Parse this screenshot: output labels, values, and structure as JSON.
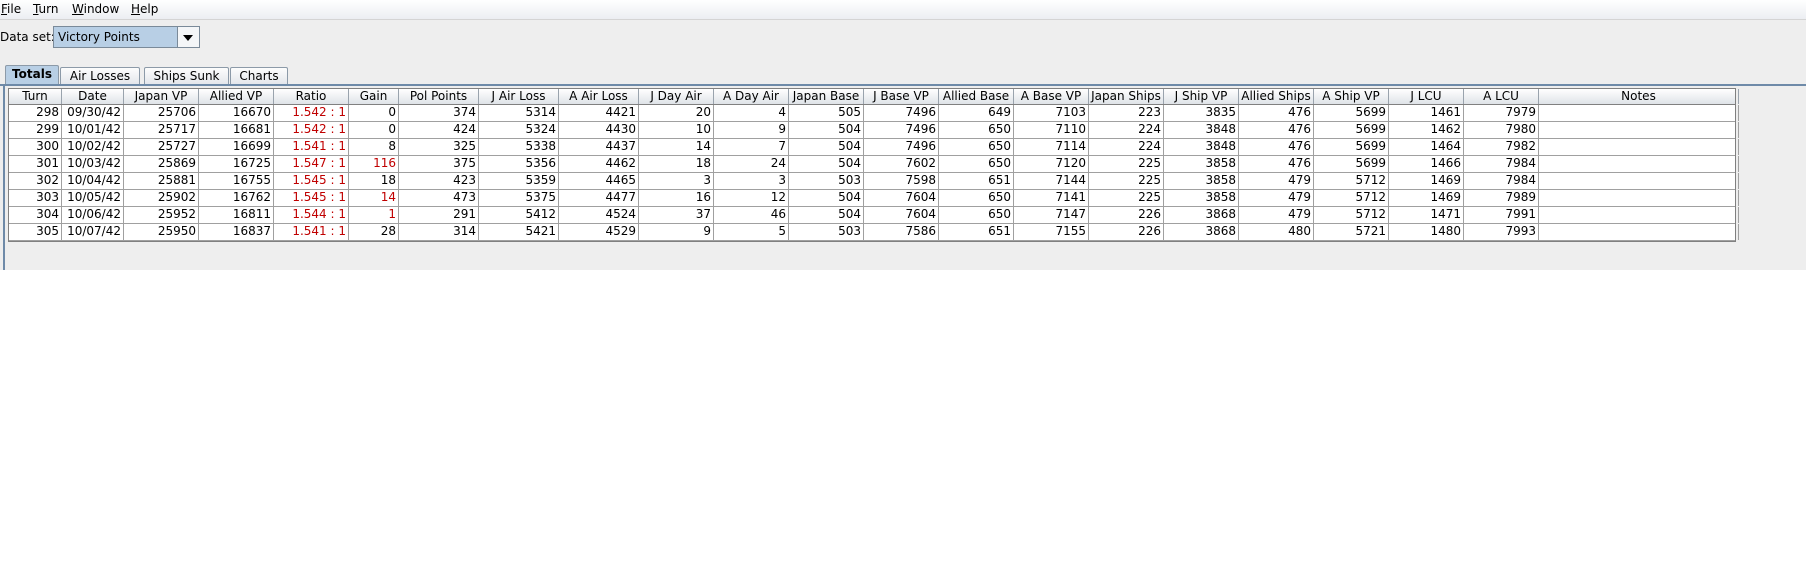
{
  "menubar": {
    "items": [
      {
        "mnemonic": "F",
        "rest": "ile"
      },
      {
        "mnemonic": "T",
        "rest": "urn"
      },
      {
        "mnemonic": "W",
        "rest": "indow"
      },
      {
        "mnemonic": "H",
        "rest": "elp"
      }
    ]
  },
  "dataset": {
    "label": "Data set:",
    "value": "Victory Points"
  },
  "tabs": [
    {
      "label": "Totals",
      "active": true
    },
    {
      "label": "Air Losses",
      "active": false
    },
    {
      "label": "Ships Sunk",
      "active": false
    },
    {
      "label": "Charts",
      "active": false
    }
  ],
  "table": {
    "columns": [
      "Turn",
      "Date",
      "Japan VP",
      "Allied VP",
      "Ratio",
      "Gain",
      "Pol Points",
      "J Air Loss",
      "A Air Loss",
      "J Day Air",
      "A Day Air",
      "Japan Base",
      "J Base VP",
      "Allied Base",
      "A Base VP",
      "Japan Ships",
      "J Ship VP",
      "Allied Ships",
      "A Ship VP",
      "J LCU",
      "A LCU",
      "Notes"
    ],
    "highlight_color": "#c00000",
    "rows": [
      {
        "cells": [
          "298",
          "09/30/42",
          "25706",
          "16670",
          "1.542 : 1",
          "0",
          "374",
          "5314",
          "4421",
          "20",
          "4",
          "505",
          "7496",
          "649",
          "7103",
          "223",
          "3835",
          "476",
          "5699",
          "1461",
          "7979",
          ""
        ],
        "red": [
          4
        ]
      },
      {
        "cells": [
          "299",
          "10/01/42",
          "25717",
          "16681",
          "1.542 : 1",
          "0",
          "424",
          "5324",
          "4430",
          "10",
          "9",
          "504",
          "7496",
          "650",
          "7110",
          "224",
          "3848",
          "476",
          "5699",
          "1462",
          "7980",
          ""
        ],
        "red": [
          4
        ]
      },
      {
        "cells": [
          "300",
          "10/02/42",
          "25727",
          "16699",
          "1.541 : 1",
          "8",
          "325",
          "5338",
          "4437",
          "14",
          "7",
          "504",
          "7496",
          "650",
          "7114",
          "224",
          "3848",
          "476",
          "5699",
          "1464",
          "7982",
          ""
        ],
        "red": [
          4
        ]
      },
      {
        "cells": [
          "301",
          "10/03/42",
          "25869",
          "16725",
          "1.547 : 1",
          "116",
          "375",
          "5356",
          "4462",
          "18",
          "24",
          "504",
          "7602",
          "650",
          "7120",
          "225",
          "3858",
          "476",
          "5699",
          "1466",
          "7984",
          ""
        ],
        "red": [
          4,
          5
        ]
      },
      {
        "cells": [
          "302",
          "10/04/42",
          "25881",
          "16755",
          "1.545 : 1",
          "18",
          "423",
          "5359",
          "4465",
          "3",
          "3",
          "503",
          "7598",
          "651",
          "7144",
          "225",
          "3858",
          "479",
          "5712",
          "1469",
          "7984",
          ""
        ],
        "red": [
          4
        ]
      },
      {
        "cells": [
          "303",
          "10/05/42",
          "25902",
          "16762",
          "1.545 : 1",
          "14",
          "473",
          "5375",
          "4477",
          "16",
          "12",
          "504",
          "7604",
          "650",
          "7141",
          "225",
          "3858",
          "479",
          "5712",
          "1469",
          "7989",
          ""
        ],
        "red": [
          4,
          5
        ]
      },
      {
        "cells": [
          "304",
          "10/06/42",
          "25952",
          "16811",
          "1.544 : 1",
          "1",
          "291",
          "5412",
          "4524",
          "37",
          "46",
          "504",
          "7604",
          "650",
          "7147",
          "226",
          "3868",
          "479",
          "5712",
          "1471",
          "7991",
          ""
        ],
        "red": [
          4,
          5
        ]
      },
      {
        "cells": [
          "305",
          "10/07/42",
          "25950",
          "16837",
          "1.541 : 1",
          "28",
          "314",
          "5421",
          "4529",
          "9",
          "5",
          "503",
          "7586",
          "651",
          "7155",
          "226",
          "3868",
          "480",
          "5721",
          "1480",
          "7993",
          ""
        ],
        "red": [
          4
        ]
      }
    ]
  }
}
